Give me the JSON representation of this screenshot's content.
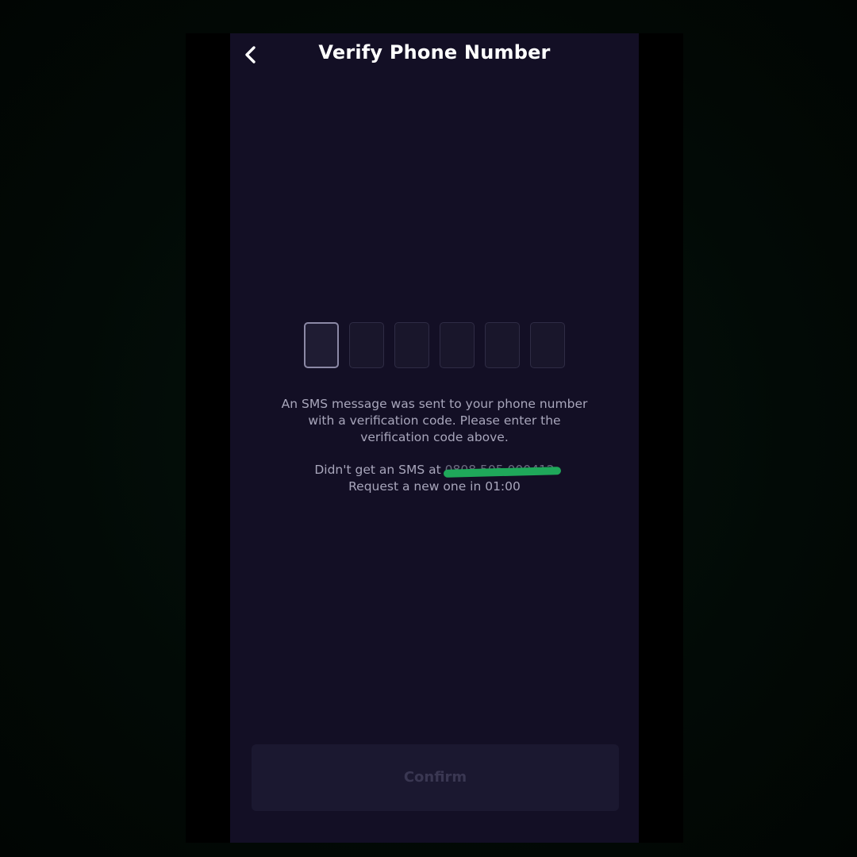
{
  "header": {
    "title": "Verify Phone Number",
    "back_icon": "chevron-left-icon"
  },
  "code_input": {
    "length": 6,
    "digits": [
      "",
      "",
      "",
      "",
      "",
      ""
    ],
    "active_index": 0
  },
  "message": {
    "line1": "An SMS message was sent to your phone number",
    "line2": "with a verification code. Please enter the",
    "line3": "verification code above."
  },
  "resend": {
    "prefix": "Didn't get an SMS at ",
    "phone_number": "0808 505 000412",
    "countdown_text": "Request a new one in 01:00"
  },
  "confirm_button": {
    "label": "Confirm",
    "enabled": false
  },
  "colors": {
    "screen_background": "#130f25",
    "title_text": "#ffffff",
    "body_text": "#a8a6bb",
    "redaction_mark": "#1fa85a",
    "button_disabled_bg": "#1b1830",
    "button_disabled_text": "#3a3752"
  }
}
